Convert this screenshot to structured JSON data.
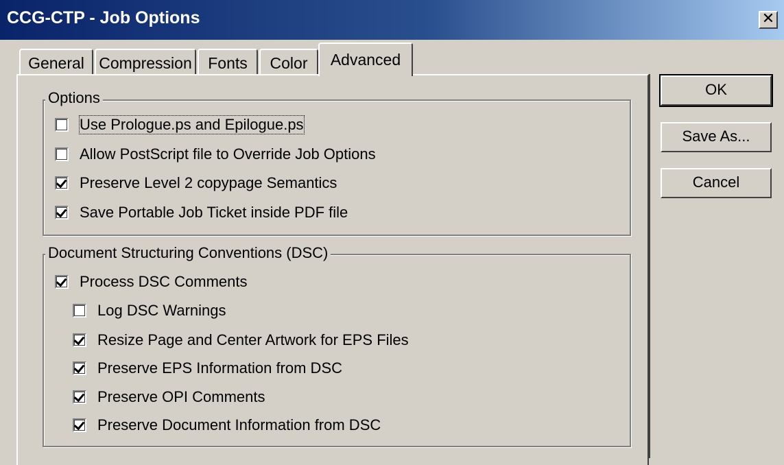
{
  "window": {
    "title": "CCG-CTP - Job Options",
    "close_glyph": "✕"
  },
  "tabs": [
    {
      "label": "General",
      "active": false
    },
    {
      "label": "Compression",
      "active": false
    },
    {
      "label": "Fonts",
      "active": false
    },
    {
      "label": "Color",
      "active": false
    },
    {
      "label": "Advanced",
      "active": true
    }
  ],
  "options_group": {
    "label": "Options",
    "items": [
      {
        "label": "Use Prologue.ps and Epilogue.ps",
        "checked": false
      },
      {
        "label": "Allow PostScript file to Override Job Options",
        "checked": false
      },
      {
        "label": "Preserve Level 2 copypage Semantics",
        "checked": true
      },
      {
        "label": "Save Portable Job Ticket inside PDF file",
        "checked": true
      }
    ]
  },
  "dsc_group": {
    "label": "Document Structuring Conventions (DSC)",
    "items": [
      {
        "label": "Process DSC Comments",
        "checked": true
      },
      {
        "label": "Log DSC Warnings",
        "checked": false
      },
      {
        "label": "Resize Page and Center Artwork for EPS Files",
        "checked": true
      },
      {
        "label": "Preserve EPS Information from DSC",
        "checked": true
      },
      {
        "label": "Preserve OPI Comments",
        "checked": true
      },
      {
        "label": "Preserve Document Information from DSC",
        "checked": true
      }
    ]
  },
  "buttons": {
    "ok": "OK",
    "save_as": "Save As...",
    "cancel": "Cancel"
  },
  "colors": {
    "titlebar_start": "#0a246a",
    "titlebar_end": "#a6caf0",
    "face": "#d4d0c8"
  }
}
